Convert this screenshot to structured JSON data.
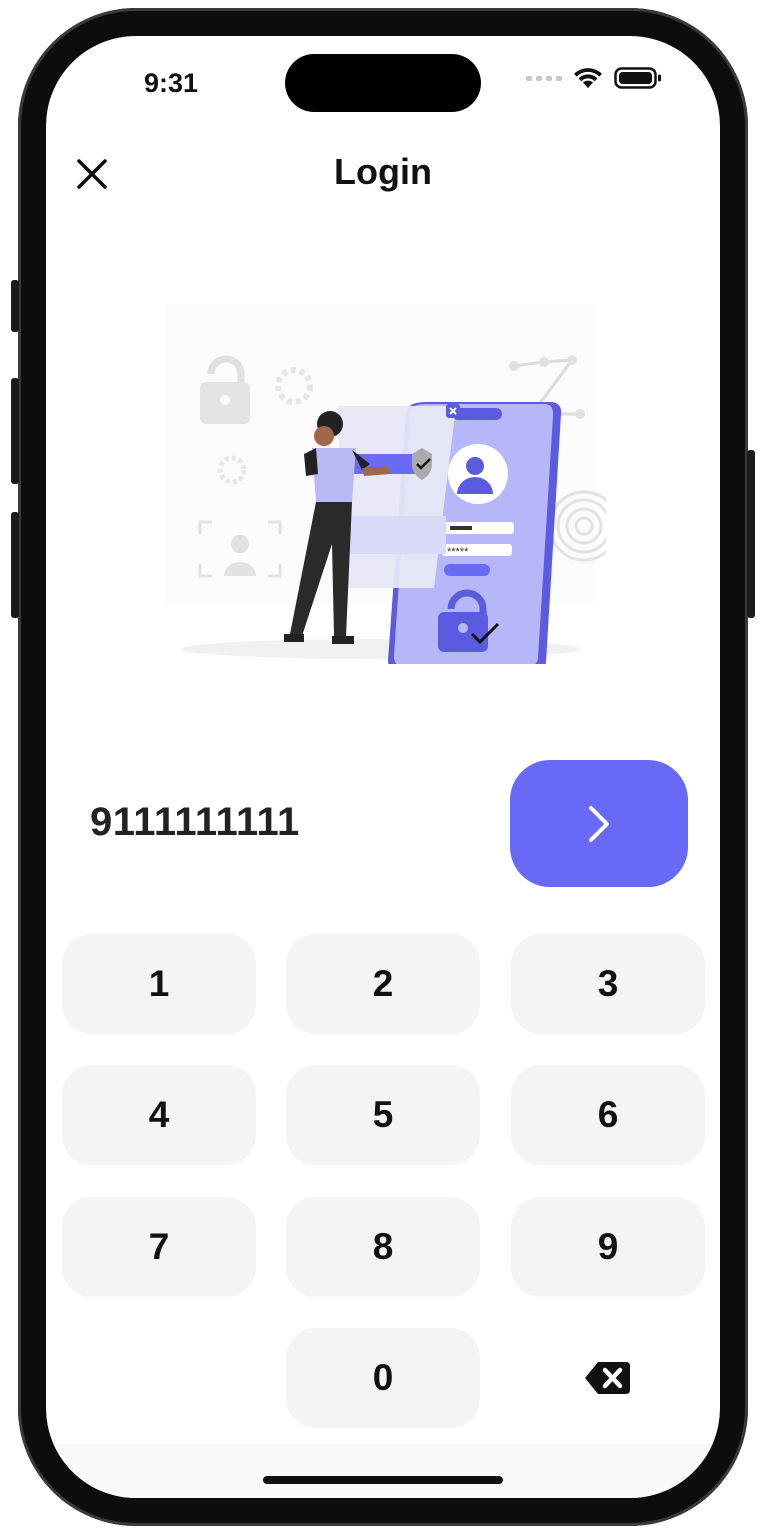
{
  "status_bar": {
    "time": "9:31"
  },
  "header": {
    "title": "Login"
  },
  "phone_input": {
    "value": "9111111111"
  },
  "keypad": {
    "keys": [
      "1",
      "2",
      "3",
      "4",
      "5",
      "6",
      "7",
      "8",
      "9",
      "0"
    ]
  },
  "icons": {
    "close": "close-icon",
    "next": "chevron-right-icon",
    "backspace": "backspace-icon",
    "wifi": "wifi-icon",
    "battery": "battery-icon",
    "signal": "signal-icon"
  },
  "illustration": {
    "mask_text": "*****"
  },
  "colors": {
    "accent": "#6869f6",
    "key_bg": "#f4f4f4",
    "text": "#111111"
  }
}
